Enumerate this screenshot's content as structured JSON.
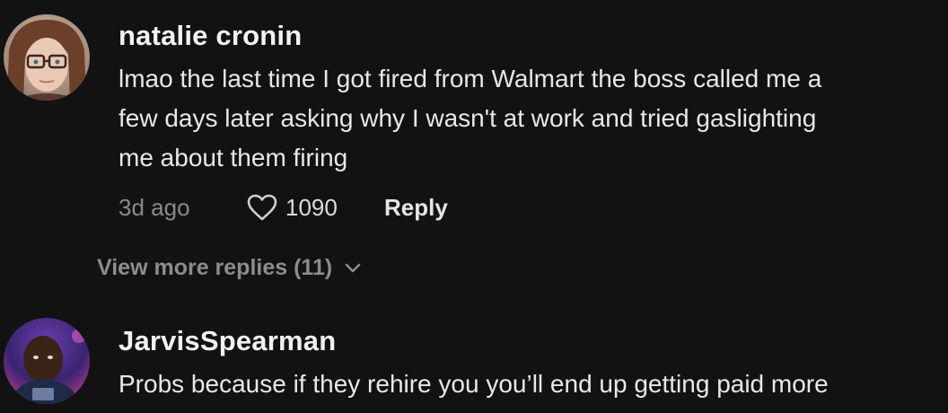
{
  "comments": [
    {
      "username": "natalie cronin",
      "text_lines": [
        "lmao the last time I got fired from Walmart the boss called me a",
        "few days later asking why I wasn't at work and tried gaslighting",
        "me about them firing"
      ],
      "time": "3d ago",
      "likes": "1090",
      "reply_label": "Reply",
      "view_more": "View more replies (11)",
      "avatar_icon": "user-avatar-photo"
    },
    {
      "username": "JarvisSpearman",
      "text_lines": [
        "Probs because if they rehire you you’ll end up getting paid more"
      ],
      "avatar_icon": "user-avatar-photo"
    }
  ],
  "icons": {
    "like": "heart-outline-icon",
    "expand": "chevron-down-icon"
  },
  "colors": {
    "background": "#121212",
    "primary_text": "#ffffff",
    "secondary_text": "#8a8a8a"
  }
}
